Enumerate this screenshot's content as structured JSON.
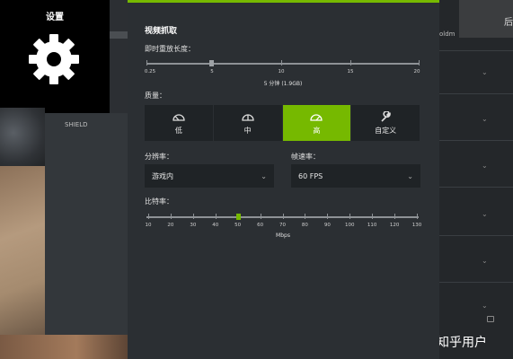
{
  "left_panel": {
    "title": "设置",
    "item": "SHIELD"
  },
  "panel": {
    "title": "视频抓取",
    "replay": {
      "label": "即时重放长度：",
      "ticks": [
        "0.25",
        "5",
        "10",
        "15",
        "20"
      ],
      "value_label": "5 分钟 (1.9GB)"
    },
    "quality": {
      "label": "质量：",
      "options": [
        {
          "label": "低",
          "icon": "gauge-low-icon"
        },
        {
          "label": "中",
          "icon": "gauge-medium-icon"
        },
        {
          "label": "高",
          "icon": "gauge-high-icon"
        },
        {
          "label": "自定义",
          "icon": "wrench-icon"
        }
      ],
      "selected": "高"
    },
    "resolution": {
      "label": "分辨率：",
      "value": "游戏内"
    },
    "framerate": {
      "label": "帧速率：",
      "value": "60 FPS"
    },
    "bitrate": {
      "label": "比特率：",
      "ticks": [
        "10",
        "20",
        "30",
        "40",
        "50",
        "60",
        "70",
        "80",
        "90",
        "100",
        "110",
        "120",
        "130"
      ],
      "unit": "Mbps",
      "value": 50
    }
  },
  "right_panel": {
    "top_text": "后",
    "partial_text": "oldm"
  },
  "watermark": "知乎用户",
  "colors": {
    "accent": "#76b900",
    "panel": "#2b2f33",
    "control": "#1f2326"
  }
}
